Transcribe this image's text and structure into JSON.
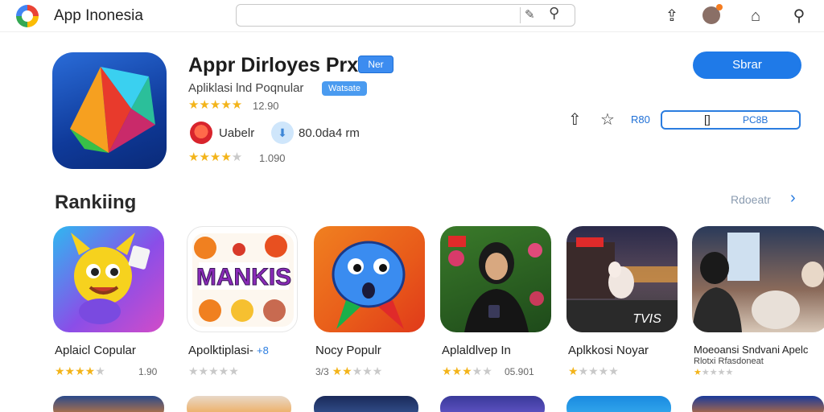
{
  "topbar": {
    "app_name": "App Inonesia",
    "search_placeholder": "",
    "icons": [
      "google-logo-icon",
      "pen-icon",
      "search-icon",
      "share-icon",
      "avatar-icon",
      "home-icon",
      "help-icon"
    ]
  },
  "hero": {
    "title": "Appr Dirloyes Prx",
    "new_badge": "Ner",
    "subtitle": "Apliklasi lnd Poqnular",
    "category_badge": "Watsate",
    "rating_value": "12.90",
    "rating_stars": 5,
    "developer": "Uabelr",
    "downloads": "80.0da4 rm",
    "second_rating_value": "1.090",
    "second_rating_stars": 4,
    "install_label": "Sbrar",
    "wishlist_label": "R80",
    "outline_button_icon": "[]",
    "outline_button_label": "PC8B"
  },
  "ranking": {
    "title": "Rankiing",
    "see_more": "Rdoeatr",
    "apps": [
      {
        "name": "Aplaicl Copular",
        "stars": 4,
        "score": "1.90"
      },
      {
        "name": "Apolktiplasi-",
        "suffix": "+8",
        "stars": 0,
        "score": ""
      },
      {
        "name": "Nocy Populr",
        "stars": 2,
        "score": "3/3"
      },
      {
        "name": "Aplaldlvep In",
        "stars": 3,
        "score": "05.901"
      },
      {
        "name": "Aplkkosi Noyar",
        "stars": 1,
        "score": ""
      },
      {
        "name": "Moeoansi Sndvani Apelc",
        "subname": "Rlotxi Rfasdoneat",
        "stars": 1,
        "score": ""
      }
    ],
    "thumb_texts": [
      "MANKIS",
      "TVIS"
    ]
  },
  "colors": {
    "accent": "#1f7ae8",
    "star": "#f3b41a",
    "star_off": "#c9c9c9"
  }
}
